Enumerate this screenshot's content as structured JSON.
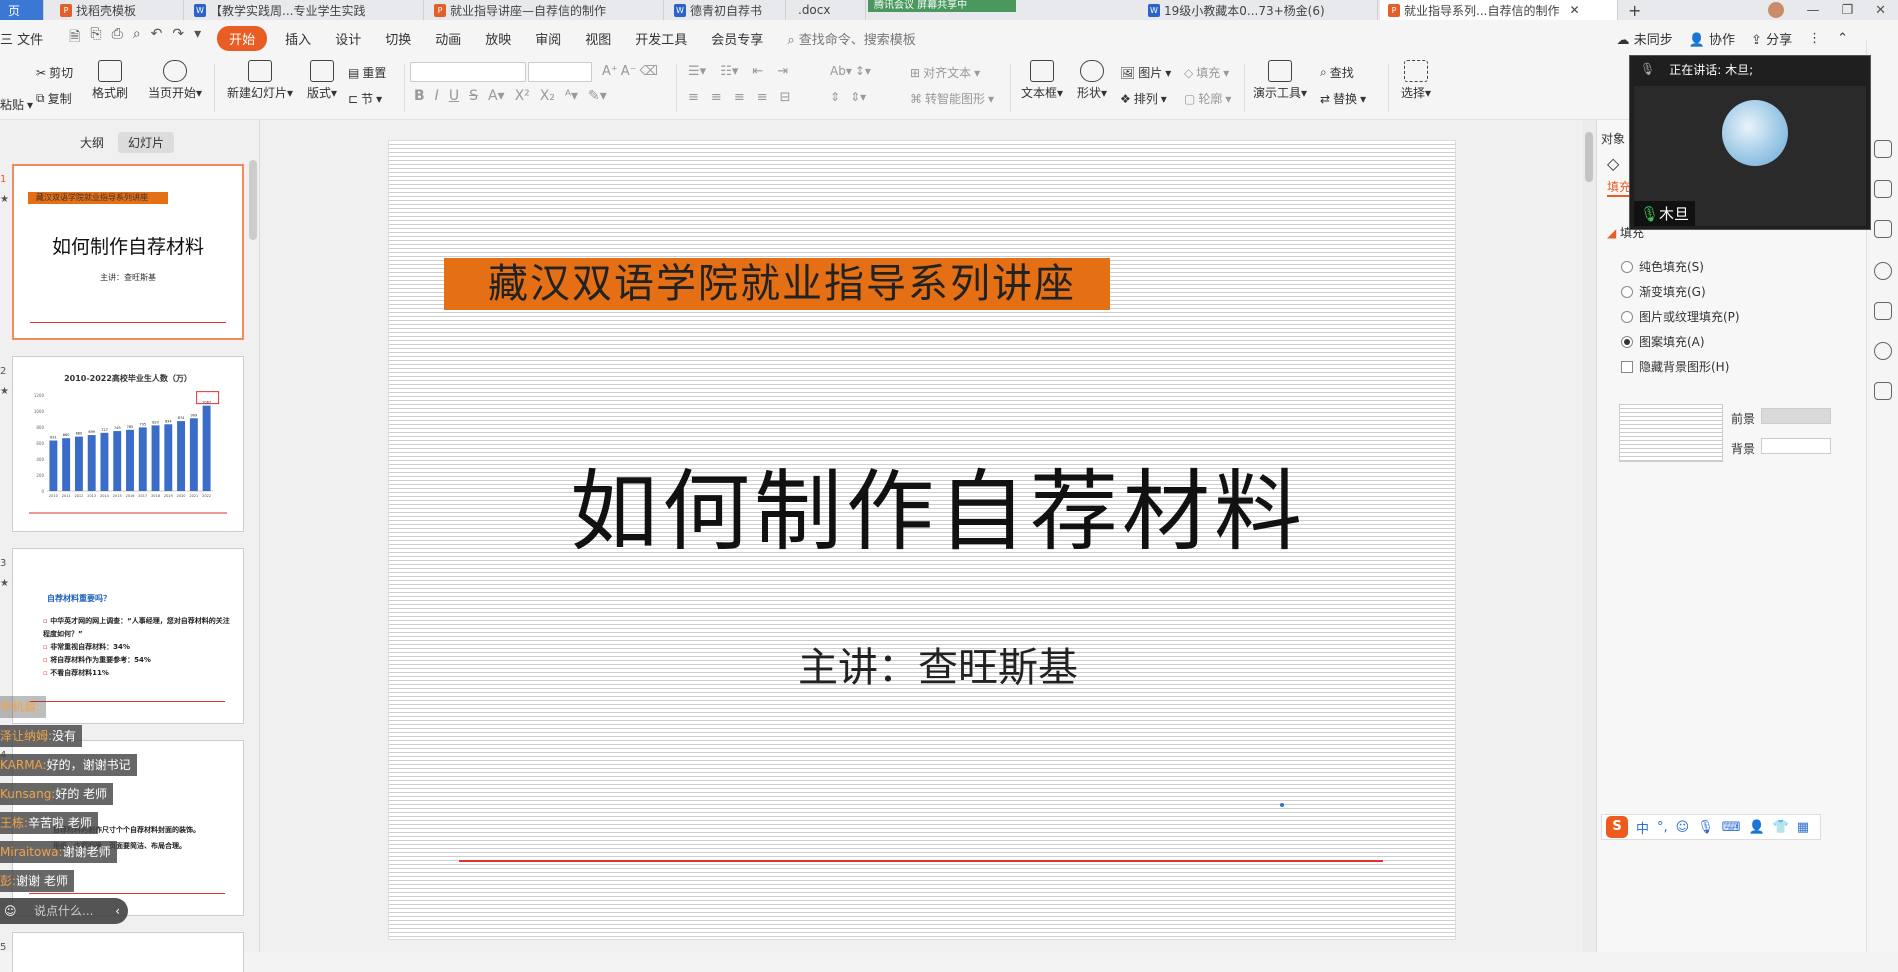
{
  "tabs": [
    {
      "label": "页",
      "type": "home"
    },
    {
      "label": "找稻壳模板",
      "icon": "p"
    },
    {
      "label": "【教学实践周...专业学生实践",
      "icon": "w"
    },
    {
      "label": "就业指导讲座—自荐信的制作",
      "icon": "p"
    },
    {
      "label": "德青初自荐书",
      "icon": "w"
    },
    {
      "label": ".docx",
      "icon": "w"
    },
    {
      "label": "19级小教藏本0...73+杨金(6)",
      "icon": "w"
    },
    {
      "label": "就业指导系列...自荐信的制作",
      "icon": "p",
      "active": true
    }
  ],
  "meeting_badge": "腾讯会议 屏幕共享中",
  "menu": {
    "file": "三 文件",
    "items": [
      "开始",
      "插入",
      "设计",
      "切换",
      "动画",
      "放映",
      "审阅",
      "视图",
      "开发工具",
      "会员专享"
    ],
    "search": "查找命令、搜索模板",
    "right": [
      "未同步",
      "协作",
      "分享"
    ]
  },
  "ribbon": {
    "paste": "粘贴",
    "cut": "剪切",
    "copy": "复制",
    "format_painter": "格式刷",
    "from_current": "当页开始",
    "new_slide": "新建幻灯片",
    "layout": "版式",
    "reset": "重置",
    "section": "节",
    "align_text": "对齐文本",
    "smart_shape": "转智能图形",
    "textbox": "文本框",
    "shape": "形状",
    "picture": "图片",
    "arrange": "排列",
    "fill": "填充",
    "outline": "轮廓",
    "present_tools": "演示工具",
    "find": "查找",
    "replace": "替换",
    "select": "选择"
  },
  "left": {
    "view_tabs": [
      "大纲",
      "幻灯片"
    ],
    "thumbs": [
      {
        "num": "1",
        "banner": "藏汉双语学院就业指导系列讲座",
        "title": "如何制作自荐材料",
        "sub": "主讲：查旺斯基"
      },
      {
        "num": "2",
        "chart_title": "2010-2022高校毕业生人数（万）"
      },
      {
        "num": "3",
        "heading": "自荐材料重要吗？",
        "bullets": [
          "中华英才网的网上调查：“人事经理，您对自荐材料的关注程度如何？”",
          "非常重视自荐材料：34%",
          "将自荐材料作为重要参考：54%",
          "不看自荐材料11%"
        ]
      },
      {
        "num": "4",
        "lines": [
          "自荐材料的制作尺寸个个自荐材料封面的装饰。",
          "用纸、内容明确、页面要简洁、布局合理。"
        ]
      },
      {
        "num": "5"
      }
    ]
  },
  "chart_data": {
    "type": "bar",
    "title": "2010-2022高校毕业生人数（万）",
    "categories": [
      "2010",
      "2011",
      "2012",
      "2013",
      "2014",
      "2015",
      "2016",
      "2017",
      "2018",
      "2019",
      "2020",
      "2021",
      "2022"
    ],
    "values": [
      631,
      660,
      680,
      699,
      727,
      749,
      765,
      795,
      820,
      834,
      874,
      909,
      1067
    ],
    "ylim": [
      0,
      1200
    ],
    "yticks": [
      0,
      200,
      400,
      600,
      800,
      1000,
      1200
    ],
    "highlight": "1067"
  },
  "slide": {
    "banner": "藏汉双语学院就业指导系列讲座",
    "title": "如何制作自荐材料",
    "speaker": "主讲：查旺斯基"
  },
  "right_panel": {
    "header": "对象",
    "tab": "填充",
    "section": "填充",
    "options": [
      {
        "label": "纯色填充(S)",
        "selected": false
      },
      {
        "label": "渐变填充(G)",
        "selected": false
      },
      {
        "label": "图片或纹理填充(P)",
        "selected": false
      },
      {
        "label": "图案填充(A)",
        "selected": true
      }
    ],
    "hide_bg": "隐藏背景图形(H)",
    "foreground": "前景",
    "background": "背景"
  },
  "video": {
    "speaking": "正在讲话: 木旦;",
    "name": "木旦"
  },
  "chat": [
    {
      "who": "寺机扁:",
      "msg": ""
    },
    {
      "who": "泽让纳姆:",
      "msg": "没有"
    },
    {
      "who": "KARMA:",
      "msg": "好的，谢谢书记"
    },
    {
      "who": "Kunsang:",
      "msg": "好的 老师"
    },
    {
      "who": "王栋:",
      "msg": "辛苦啦 老师"
    },
    {
      "who": "Miraitowa:",
      "msg": "谢谢老师"
    },
    {
      "who": "彭:",
      "msg": "谢谢 老师"
    }
  ],
  "chat_input": "说点什么...",
  "ime": {
    "lang": "中"
  }
}
